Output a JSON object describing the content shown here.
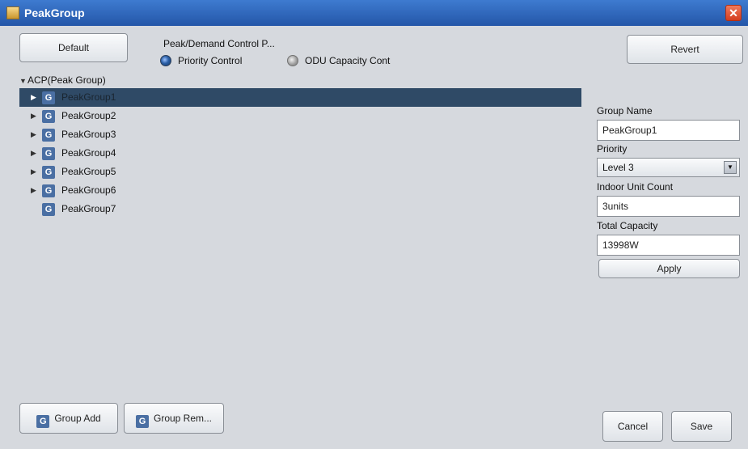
{
  "window": {
    "title": "PeakGroup",
    "close_glyph": "✕"
  },
  "toolbar": {
    "default_label": "Default",
    "revert_label": "Revert"
  },
  "control_mode": {
    "label": "Peak/Demand Control P...",
    "options": [
      {
        "label": "Priority Control",
        "selected": true
      },
      {
        "label": "ODU Capacity Cont",
        "selected": false
      }
    ]
  },
  "tree": {
    "root_label": "ACP(Peak Group)",
    "items": [
      {
        "label": "PeakGroup1",
        "expandable": true,
        "selected": true
      },
      {
        "label": "PeakGroup2",
        "expandable": true,
        "selected": false
      },
      {
        "label": "PeakGroup3",
        "expandable": true,
        "selected": false
      },
      {
        "label": "PeakGroup4",
        "expandable": true,
        "selected": false
      },
      {
        "label": "PeakGroup5",
        "expandable": true,
        "selected": false
      },
      {
        "label": "PeakGroup6",
        "expandable": true,
        "selected": false
      },
      {
        "label": "PeakGroup7",
        "expandable": false,
        "selected": false
      }
    ],
    "item_icon": "G"
  },
  "details": {
    "group_name_label": "Group Name",
    "group_name_value": "PeakGroup1",
    "priority_label": "Priority",
    "priority_value": "Level 3",
    "indoor_count_label": "Indoor Unit Count",
    "indoor_count_value": "3units",
    "total_capacity_label": "Total Capacity",
    "total_capacity_value": "13998W",
    "apply_label": "Apply"
  },
  "footer": {
    "group_add_label": "Group Add",
    "group_remove_label": "Group Rem...",
    "cancel_label": "Cancel",
    "save_label": "Save"
  },
  "colors": {
    "title_bar": "#2f63b5",
    "selection": "#2f4a66",
    "background": "#d6d9de"
  }
}
